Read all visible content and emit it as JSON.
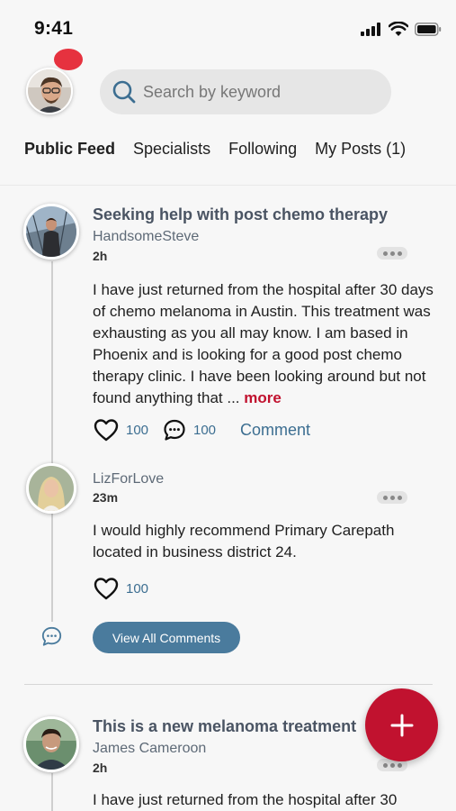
{
  "status_bar": {
    "time": "9:41"
  },
  "search": {
    "placeholder": "Search by keyword"
  },
  "tabs": [
    {
      "label": "Public Feed",
      "active": true
    },
    {
      "label": "Specialists",
      "active": false
    },
    {
      "label": "Following",
      "active": false
    },
    {
      "label": "My Posts (1)",
      "active": false
    }
  ],
  "posts": [
    {
      "title": "Seeking help with post chemo therapy",
      "author": "HandsomeSteve",
      "time": "2h",
      "body": "I have just returned from the hospital after 30 days of chemo melanoma in Austin. This treatment was exhausting as you all may know. I am based in Phoenix and is looking for a good post chemo therapy clinic. I have been looking around but not found anything that ...",
      "more_label": "more",
      "likes": "100",
      "comments": "100",
      "comment_label": "Comment"
    },
    {
      "title": "This is a new melanoma treatment",
      "author": "James Cameroon",
      "time": "2h",
      "body": "I have just returned from the hospital after 30"
    }
  ],
  "reply": {
    "author": "LizForLove",
    "time": "23m",
    "body": "I would highly recommend Primary Carepath located in business district 24.",
    "likes": "100"
  },
  "view_all_label": "View All Comments",
  "colors": {
    "accent": "#c1122f",
    "link": "#3c6e91",
    "button": "#4a7b9d",
    "title": "#4a5463"
  }
}
